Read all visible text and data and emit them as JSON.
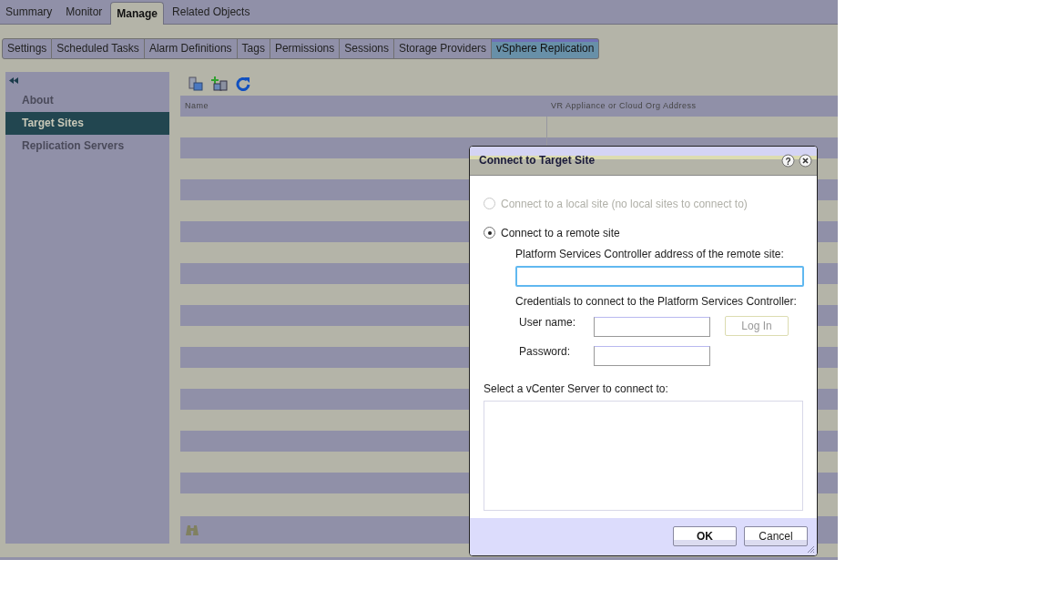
{
  "top_tabs": [
    {
      "label": "Summary",
      "selected": false
    },
    {
      "label": "Monitor",
      "selected": false
    },
    {
      "label": "Manage",
      "selected": true
    },
    {
      "label": "Related Objects",
      "selected": false
    }
  ],
  "sub_tabs": [
    {
      "label": "Settings",
      "selected": false
    },
    {
      "label": "Scheduled Tasks",
      "selected": false
    },
    {
      "label": "Alarm Definitions",
      "selected": false
    },
    {
      "label": "Tags",
      "selected": false
    },
    {
      "label": "Permissions",
      "selected": false
    },
    {
      "label": "Sessions",
      "selected": false
    },
    {
      "label": "Storage Providers",
      "selected": false
    },
    {
      "label": "vSphere Replication",
      "selected": true
    }
  ],
  "sidebar": {
    "items": [
      {
        "label": "About",
        "selected": false
      },
      {
        "label": "Target Sites",
        "selected": true
      },
      {
        "label": "Replication Servers",
        "selected": false
      }
    ]
  },
  "table": {
    "columns": [
      "Name",
      "VR Appliance or Cloud Org Address"
    ]
  },
  "dialog": {
    "title": "Connect to Target Site",
    "help_glyph": "?",
    "options": [
      {
        "label": "Connect to a local site (no local sites to connect to)",
        "selected": false,
        "disabled": true
      },
      {
        "label": "Connect to a remote site",
        "selected": true,
        "disabled": false
      }
    ],
    "address_label": "Platform Services Controller address of the remote site:",
    "credentials_label": "Credentials to connect to the Platform Services Controller:",
    "username_label": "User name:",
    "password_label": "Password:",
    "login_button": {
      "label": "Log In",
      "disabled": true
    },
    "vcenter_label": "Select a vCenter Server to connect to:",
    "buttons": [
      {
        "label": "OK",
        "kind": "primary"
      },
      {
        "label": "Cancel",
        "kind": "secondary"
      }
    ]
  }
}
